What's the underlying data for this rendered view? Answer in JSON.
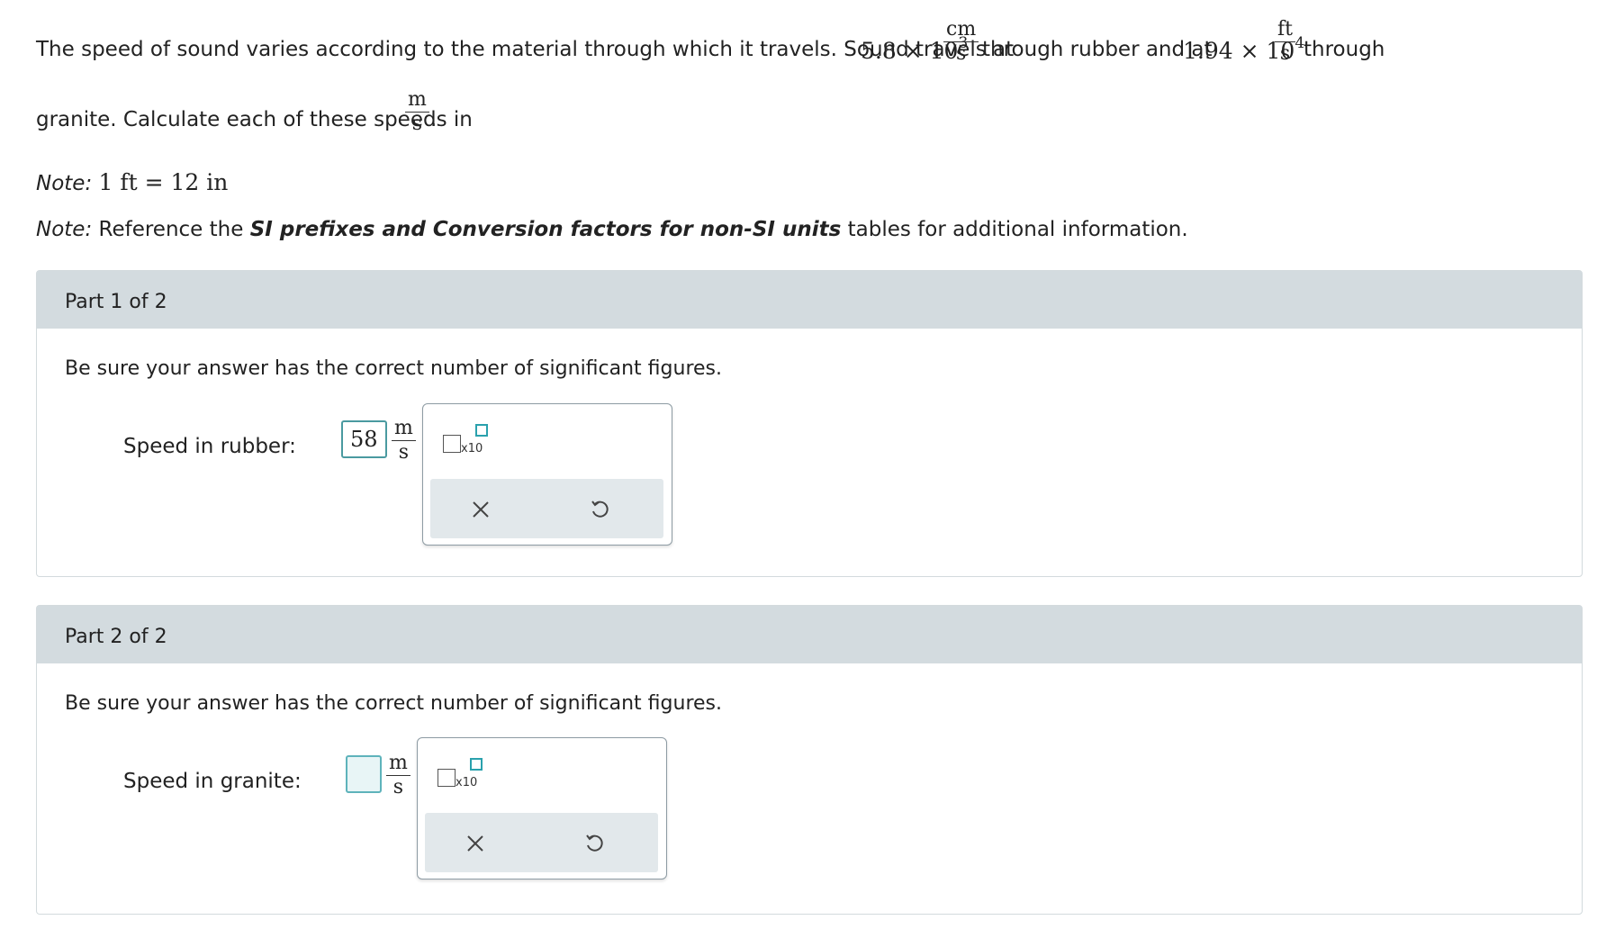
{
  "problem": {
    "intro": "The speed of sound varies according to the material through which it travels. Sound travels at",
    "rubber_value": {
      "mantissa": "5.8",
      "times": "×",
      "base": "10",
      "exponent": "3"
    },
    "rubber_unit": {
      "num": "cm",
      "den": "s"
    },
    "mid": "through rubber and at",
    "granite_value": {
      "mantissa": "1.94",
      "times": "×",
      "base": "10",
      "exponent": "4"
    },
    "granite_unit": {
      "num": "ft",
      "den": "s"
    },
    "tail": "through",
    "line2": "granite. Calculate each of these speeds in",
    "target_unit": {
      "num": "m",
      "den": "s"
    },
    "period": ".",
    "note_label": "Note:",
    "note1_math": "1  ft = 12  in",
    "note2_pre": "Reference the",
    "note2_bold": "SI prefixes and Conversion factors for non-SI units",
    "note2_post": "tables for additional information."
  },
  "parts": [
    {
      "header": "Part 1 of 2",
      "instruction": "Be sure your answer has the correct number of significant figures.",
      "label": "Speed in rubber:",
      "value": "58",
      "unit": {
        "num": "m",
        "den": "s"
      },
      "x10_label": "x10"
    },
    {
      "header": "Part 2 of 2",
      "instruction": "Be sure your answer has the correct number of significant figures.",
      "label": "Speed in granite:",
      "value": "",
      "unit": {
        "num": "m",
        "den": "s"
      },
      "x10_label": "x10"
    }
  ],
  "colors": {
    "header_bg": "#d3dbdf",
    "accent": "#2aa1ad",
    "toolbar_bg": "#e2e8eb"
  }
}
